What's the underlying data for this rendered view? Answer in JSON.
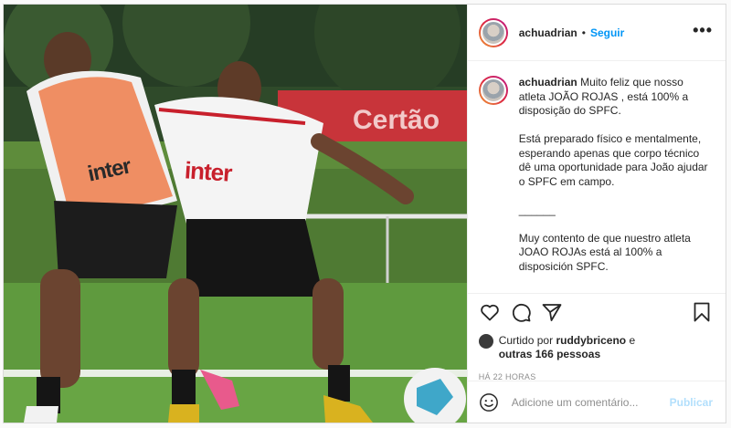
{
  "post": {
    "username": "achuadrian",
    "follow_label": "Seguir",
    "more_label": "•••",
    "photo": {
      "sponsor_left": "inter",
      "sponsor_right": "inter",
      "banner_text": "Certão"
    },
    "caption": {
      "username": "achuadrian",
      "paragraphs": [
        "Muito feliz que nosso atleta JOÃO ROJAS , está 100% a disposição do SPFC.",
        "Está preparado físico e mentalmente, esperando apenas que corpo técnico dê uma oportunidade para João ajudar o SPFC em campo.",
        "______",
        "Muy contento de que nuestro atleta JOAO ROJAs está al 100% a disposición SPFC."
      ]
    },
    "likes": {
      "prefix": "Curtido por",
      "liker": "ruddybriceno",
      "connector": "e",
      "others": "outras 166 pessoas"
    },
    "timestamp": "HÁ 22 HORAS",
    "comment_placeholder": "Adicione um comentário...",
    "publish_label": "Publicar",
    "icons": [
      "heart-icon",
      "comment-icon",
      "share-icon",
      "bookmark-icon",
      "emoji-icon"
    ]
  }
}
